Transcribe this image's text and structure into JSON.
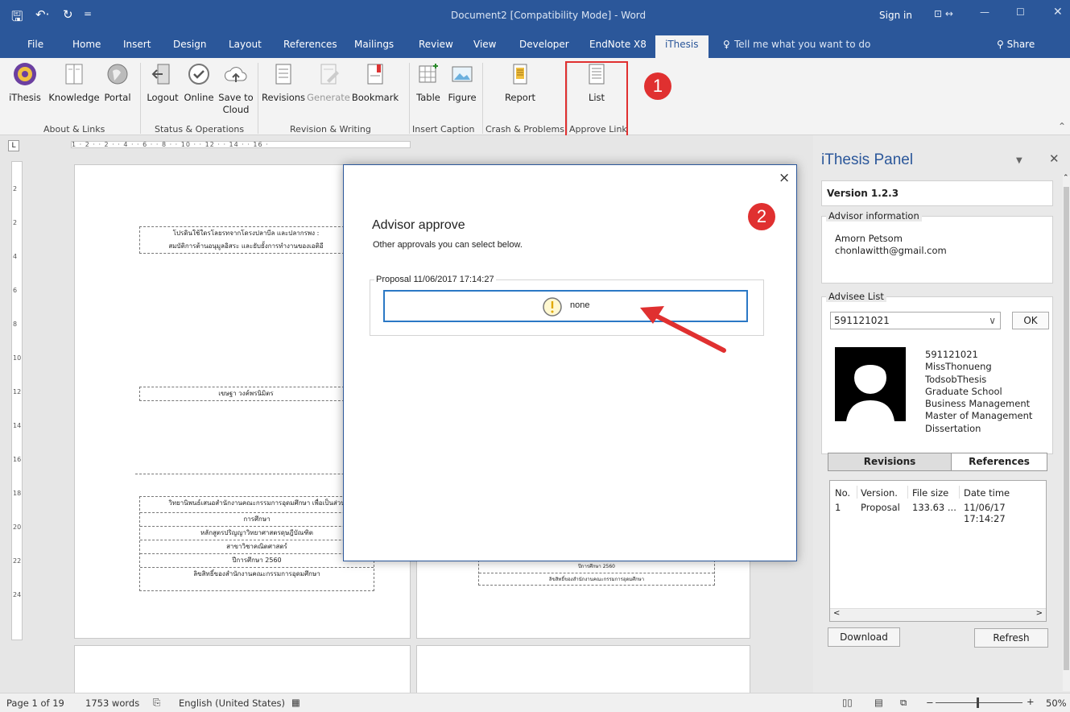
{
  "titlebar": {
    "title": "Document2 [Compatibility Mode]  -  Word",
    "sign_in": "Sign in"
  },
  "tabs": [
    "File",
    "Home",
    "Insert",
    "Design",
    "Layout",
    "References",
    "Mailings",
    "Review",
    "View",
    "Developer",
    "EndNote X8",
    "iThesis"
  ],
  "tell_me": "Tell me what you want to do",
  "share": "Share",
  "ribbon": {
    "buttons": {
      "ithesis": "iThesis",
      "knowledge": "Knowledge",
      "portal": "Portal",
      "logout": "Logout",
      "online": "Online",
      "save_to_cloud_1": "Save to",
      "save_to_cloud_2": "Cloud",
      "revisions": "Revisions",
      "generate": "Generate",
      "bookmark": "Bookmark",
      "table": "Table",
      "figure": "Figure",
      "report": "Report",
      "list": "List"
    },
    "groups": {
      "about": "About & Links",
      "status": "Status & Operations",
      "revision": "Revision & Writing",
      "caption": "Insert Caption",
      "crash": "Crash & Problems",
      "approve": "Approve Link"
    }
  },
  "ruler_text": "1 · 2 ·   · 2 · · 4 · · 6 · · 8 · · 10 · · 12 · · 14 · · 16 ·",
  "vruler_marks": [
    "2",
    "2",
    "4",
    "6",
    "8",
    "10",
    "12",
    "14",
    "16",
    "18",
    "20",
    "22",
    "24"
  ],
  "document": {
    "box1_line1": "โปรดินใช้ใดรโลยรทจากโดรงปลาบีล และปลากรพง :",
    "box1_line2": "สมบัติการต้านอนุมูลอิสระ และยับยั้งการทำงานของเอติอี",
    "name": "เขษฐา วงค์พรนิมิตร",
    "l1": "วิทยานิพนธ์เสนอสำนักงานคณะกรรมการอุดมศึกษา เพื่อเป็นส่วน",
    "l2": "การศึกษา",
    "l3": "หลักสูตรปริญญาวิทยาศาสตรดุษฎีบัณฑิต",
    "l4": "สาขาวิชาคณิตศาสตร์",
    "l5": "ปีการศึกษา 2560",
    "l6": "ลิขสิทธิ์ของสำนักงานคณะกรรมการอุดมศึกษา",
    "r5": "ปีการศึกษา 2560",
    "r6": "ลิขสิทธิ์ของสำนักงานคณะกรรมการอุดมศึกษา"
  },
  "dialog": {
    "title": "Advisor approve",
    "subtitle": "Other approvals you can select below.",
    "group_label": "Proposal 11/06/2017 17:14:27",
    "status_text": "none",
    "close": "×"
  },
  "panel": {
    "title": "iThesis Panel",
    "version": "Version 1.2.3",
    "advisor_legend": "Advisor information",
    "advisor_name": "Amorn Petsom",
    "advisor_email": "chonlawitth@gmail.com",
    "advisee_legend": "Advisee List",
    "advisee_value": "591121021",
    "ok": "OK",
    "student": [
      "591121021",
      "MissThonueng",
      "TodsobThesis",
      "Graduate School",
      "Business Management",
      "Master of Management",
      "Dissertation"
    ],
    "tab_revisions": "Revisions",
    "tab_references": "References",
    "columns": [
      "No.",
      "Version.",
      "File size",
      "Date time"
    ],
    "rows": [
      [
        "1",
        "Proposal",
        "133.63 ...",
        "11/06/17 17:14:27"
      ]
    ],
    "download": "Download",
    "refresh": "Refresh"
  },
  "annotations": {
    "one": "1",
    "two": "2"
  },
  "status": {
    "page": "Page 1 of 19",
    "words": "1753 words",
    "language": "English (United States)",
    "zoom": "50%"
  },
  "colors": {
    "accent": "#2b579a",
    "highlight": "#e03030",
    "dialog_border": "#2b579a"
  }
}
